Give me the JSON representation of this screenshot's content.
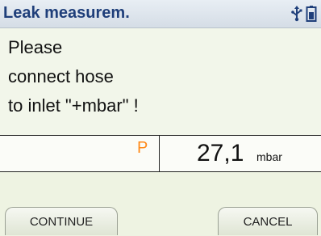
{
  "title": "Leak measurem.",
  "status_icons": [
    "usb-icon",
    "battery-icon"
  ],
  "message": {
    "line1": "Please",
    "line2": "connect hose",
    "line3": "to inlet \"+mbar\" !"
  },
  "measurement": {
    "symbol": "P",
    "value": "27,1",
    "unit": "mbar"
  },
  "softkeys": {
    "left": "CONTINUE",
    "right": "CANCEL"
  },
  "colors": {
    "title": "#1f3f7a",
    "symbol": "#ff8a1a",
    "background": "#eef3e2"
  }
}
